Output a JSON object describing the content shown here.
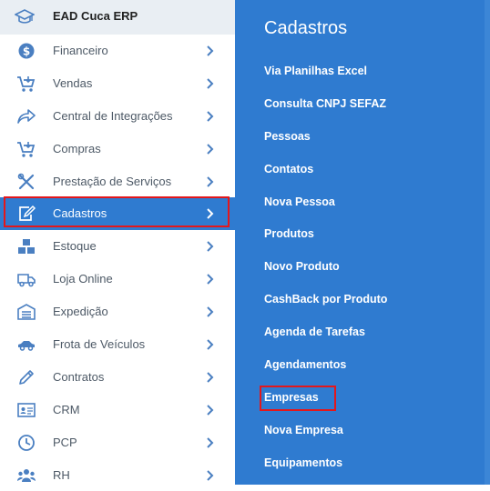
{
  "app": {
    "title": "EAD Cuca ERP"
  },
  "sidebar": {
    "items": [
      {
        "label": "Financeiro",
        "icon": "dollar-icon"
      },
      {
        "label": "Vendas",
        "icon": "cart-icon"
      },
      {
        "label": "Central de Integrações",
        "icon": "share-icon"
      },
      {
        "label": "Compras",
        "icon": "cart-icon"
      },
      {
        "label": "Prestação de Serviços",
        "icon": "tools-icon"
      },
      {
        "label": "Cadastros",
        "icon": "edit-icon",
        "active": true
      },
      {
        "label": "Estoque",
        "icon": "boxes-icon"
      },
      {
        "label": "Loja Online",
        "icon": "truck-icon"
      },
      {
        "label": "Expedição",
        "icon": "warehouse-icon"
      },
      {
        "label": "Frota de Veículos",
        "icon": "car-icon"
      },
      {
        "label": "Contratos",
        "icon": "pencil-icon"
      },
      {
        "label": "CRM",
        "icon": "id-card-icon"
      },
      {
        "label": "PCP",
        "icon": "clock-icon"
      },
      {
        "label": "RH",
        "icon": "users-icon"
      }
    ]
  },
  "panel": {
    "title": "Cadastros",
    "items": [
      "Via Planilhas Excel",
      "Consulta CNPJ SEFAZ",
      "Pessoas",
      "Contatos",
      "Nova Pessoa",
      "Produtos",
      "Novo Produto",
      "CashBack por Produto",
      "Agenda de Tarefas",
      "Agendamentos",
      "Empresas",
      "Nova Empresa",
      "Equipamentos"
    ],
    "highlighted": "Empresas"
  },
  "colors": {
    "accent": "#2f7bd0",
    "highlight_border": "#e3171b",
    "sidebar_text": "#4d5966",
    "icon": "#4a7fc1"
  }
}
